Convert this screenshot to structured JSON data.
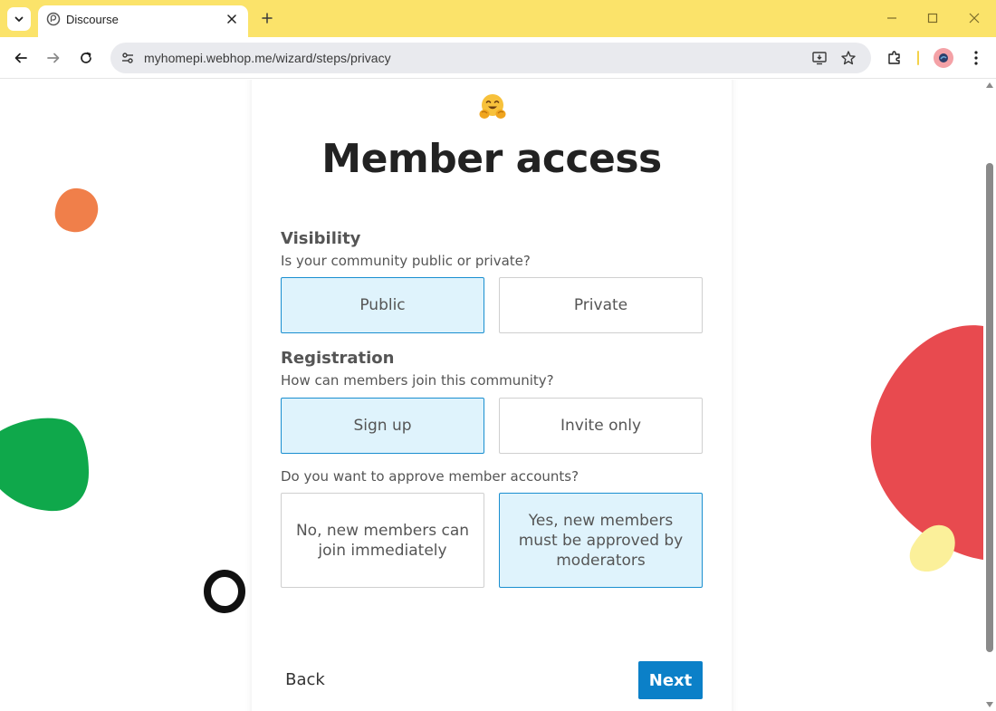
{
  "browser": {
    "tab_title": "Discourse",
    "url": "myhomepi.webhop.me/wizard/steps/privacy"
  },
  "page": {
    "heading": "Member access",
    "emoji": "hugging-face-emoji",
    "visibility": {
      "title": "Visibility",
      "question": "Is your community public or private?",
      "options": [
        "Public",
        "Private"
      ],
      "selected": "Public"
    },
    "registration": {
      "title": "Registration",
      "question": "How can members join this community?",
      "options": [
        "Sign up",
        "Invite only"
      ],
      "selected": "Sign up"
    },
    "approval": {
      "question": "Do you want to approve member accounts?",
      "options": [
        "No, new members can join immediately",
        "Yes, new members must be approved by moderators"
      ],
      "selected": "Yes, new members must be approved by moderators"
    },
    "back_label": "Back",
    "next_label": "Next"
  },
  "colors": {
    "accent": "#0b80c8",
    "selected_bg": "#dff3fc",
    "tabstrip": "#fbe36a",
    "blob_orange": "#f07f4a",
    "blob_green": "#0fa84b",
    "blob_red": "#e84a4f",
    "blob_yellow": "#fbf09a"
  }
}
